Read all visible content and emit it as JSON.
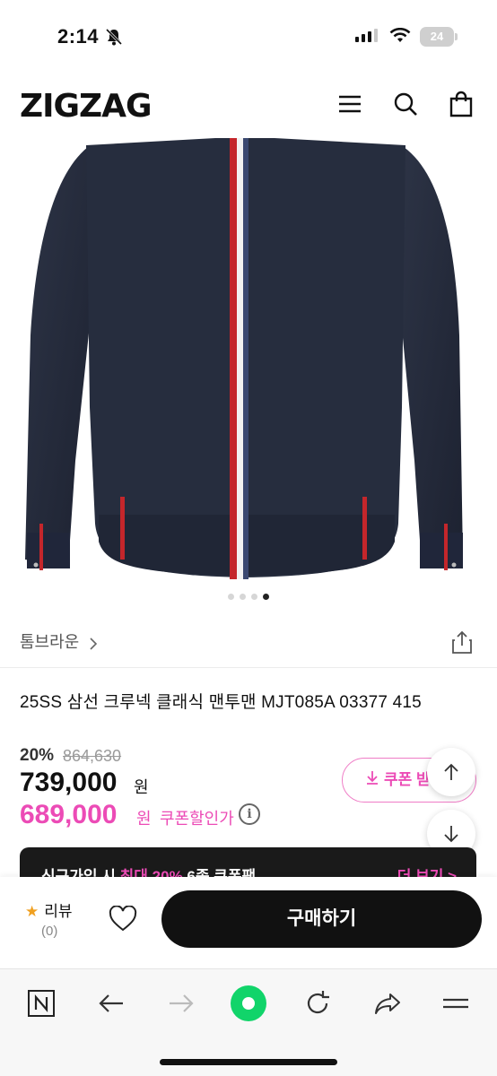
{
  "status_bar": {
    "time": "2:14",
    "battery": "24"
  },
  "header": {
    "logo": "ZIGZAG"
  },
  "carousel": {
    "count": 4,
    "active": 4
  },
  "product": {
    "brand": "톰브라운",
    "title": "25SS 삼선 크루넥 클래식 맨투맨 MJT085A 03377 415",
    "discount": "20%",
    "original_price": "864,630",
    "price": "739,000",
    "price_unit": "원",
    "coupon_price": "689,000",
    "coupon_price_unit": "원",
    "coupon_price_label": "쿠폰할인가",
    "coupon_button": "쿠폰 받"
  },
  "banner": {
    "text_prefix": "신규가입 시 ",
    "text_highlight": "최대 20%",
    "text_suffix": " 6종 쿠폰팩",
    "more": "더 보기 >"
  },
  "buy_bar": {
    "review_label": "리뷰",
    "review_count": "(0)",
    "buy_button": "구매하기"
  },
  "colors": {
    "accent_pink": "#ec4bb6",
    "primary_black": "#111111",
    "jacket_navy": "#252c3c"
  }
}
